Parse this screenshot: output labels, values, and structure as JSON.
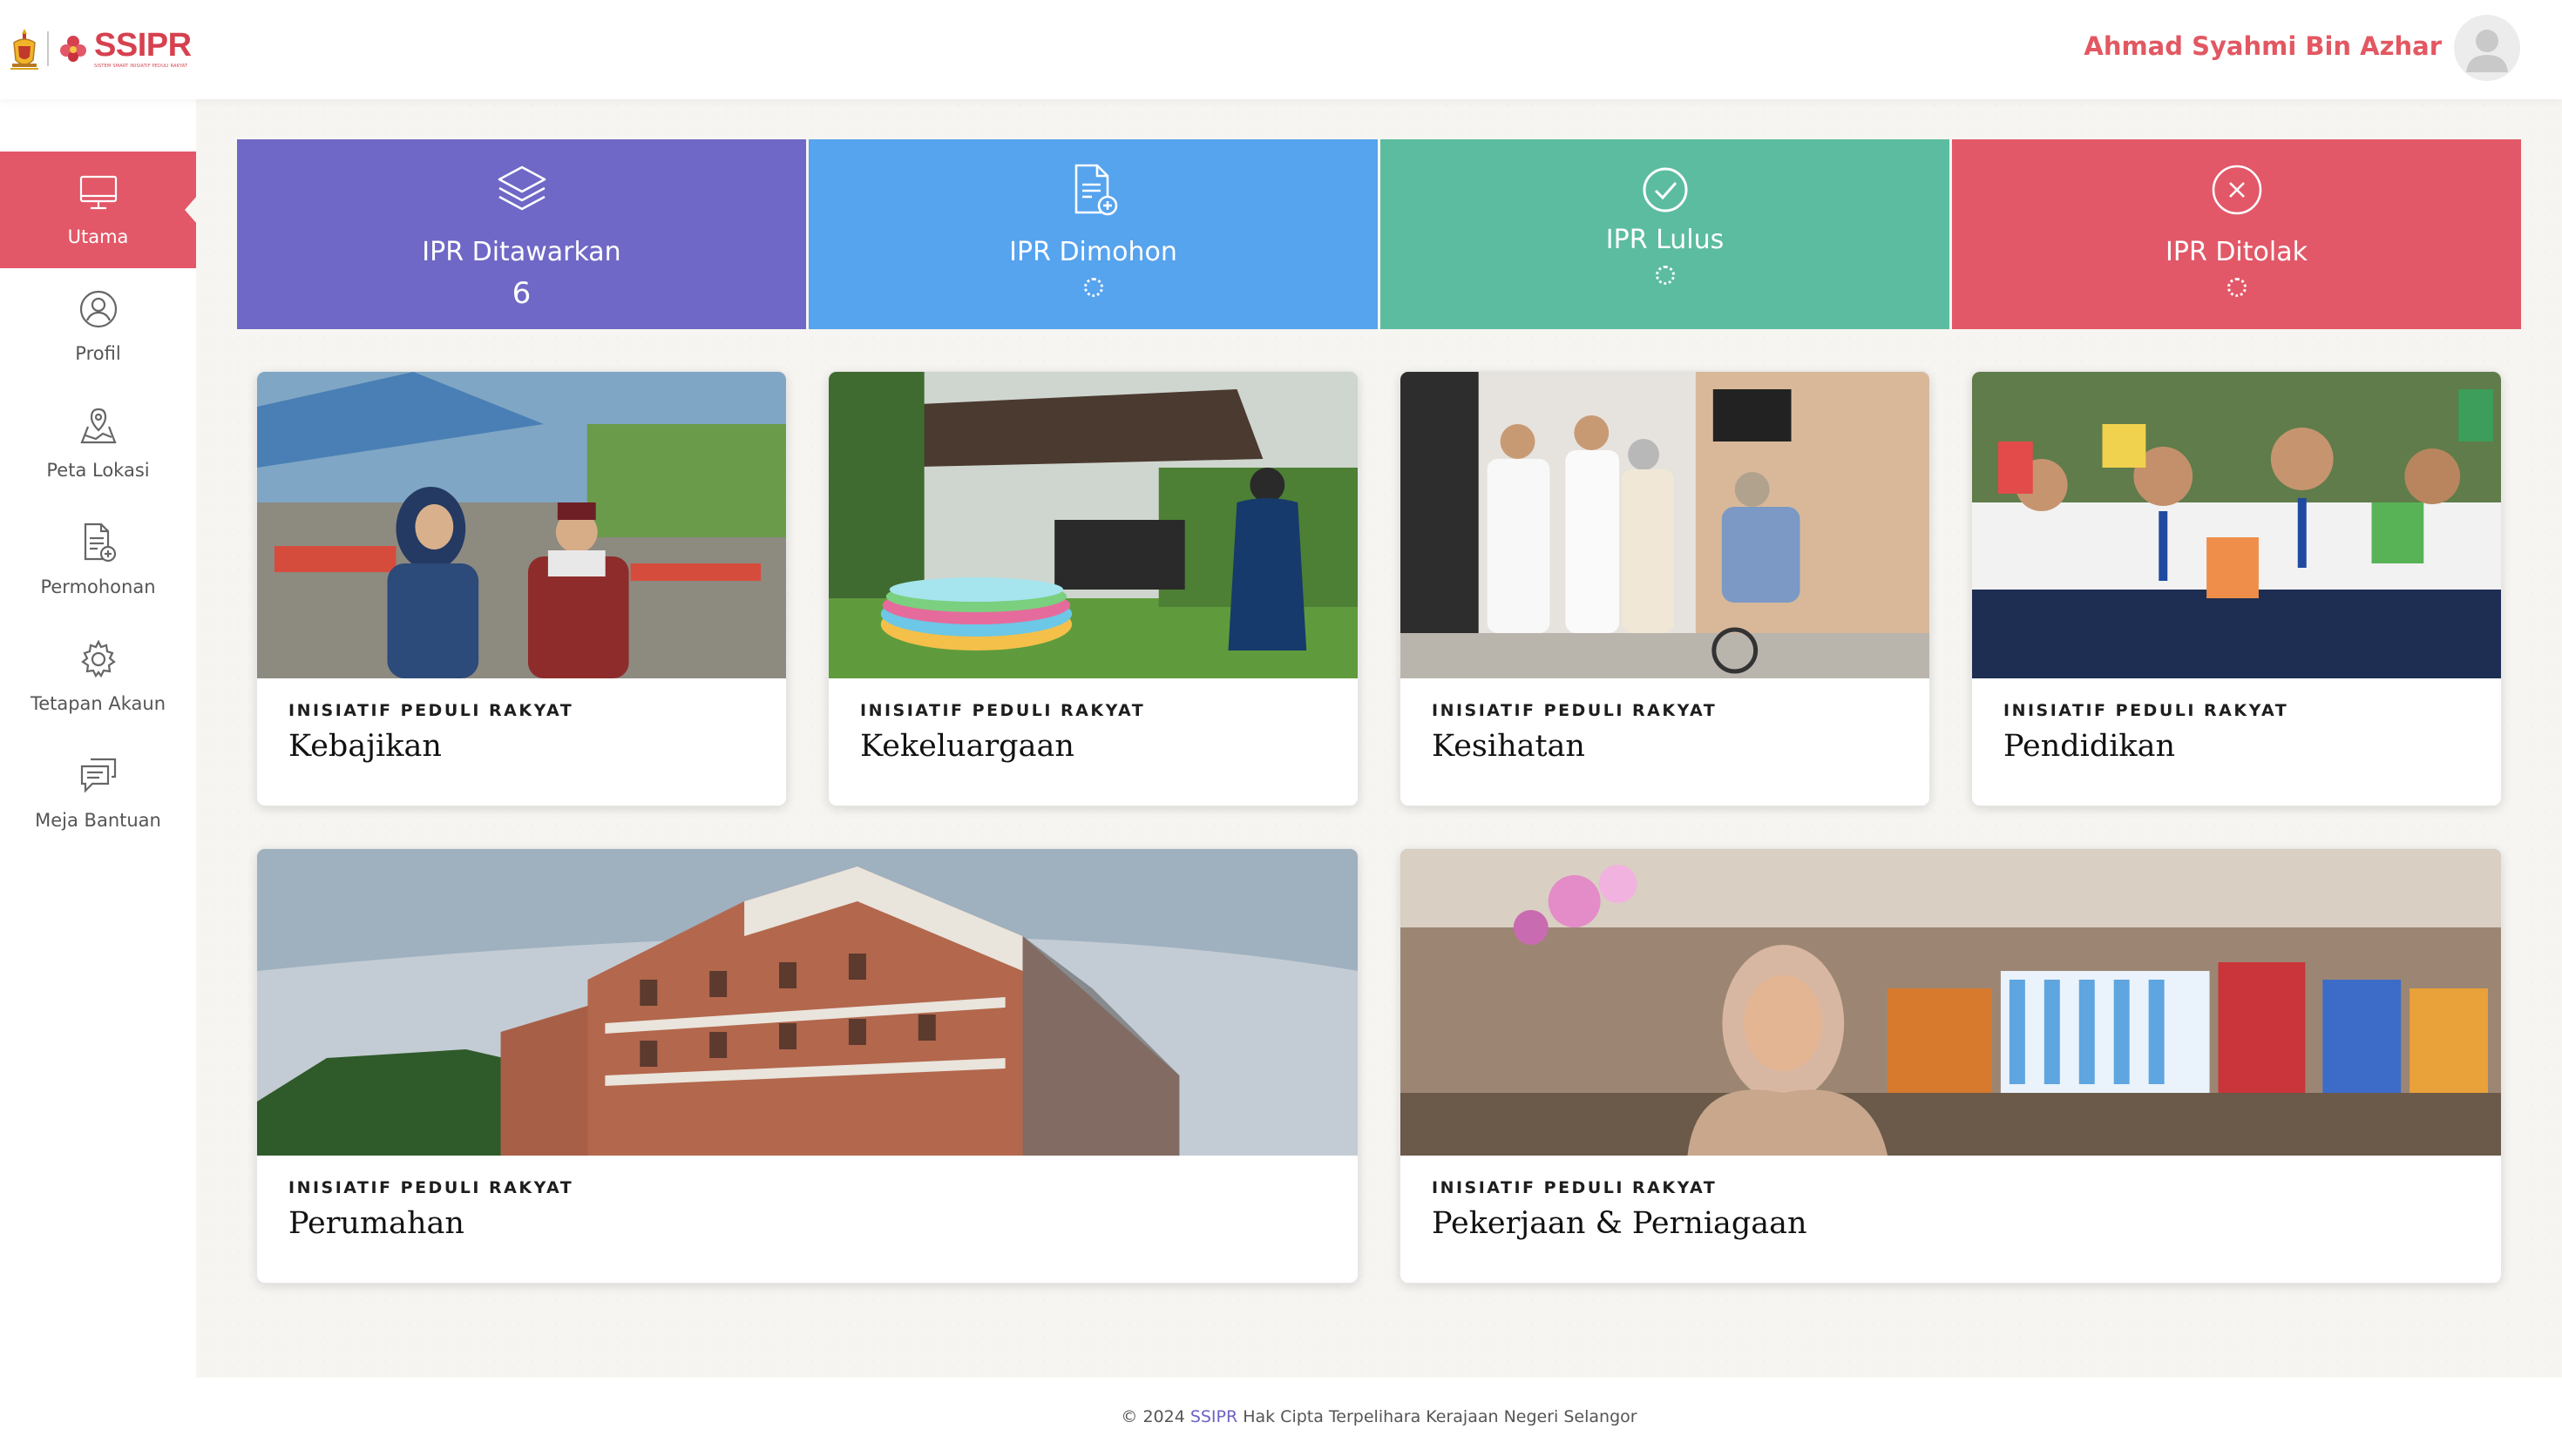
{
  "app": {
    "logo_text": "SSIPR",
    "logo_subtext": "SISTEM SMART INISIATIF PEDULI RAKYAT",
    "user_name": "Ahmad Syahmi Bin Azhar"
  },
  "sidebar": {
    "items": [
      {
        "label": "Utama",
        "icon": "monitor-icon",
        "active": true
      },
      {
        "label": "Profil",
        "icon": "user-circle-icon",
        "active": false
      },
      {
        "label": "Peta Lokasi",
        "icon": "map-pin-icon",
        "active": false
      },
      {
        "label": "Permohonan",
        "icon": "document-add-icon",
        "active": false
      },
      {
        "label": "Tetapan Akaun",
        "icon": "gear-icon",
        "active": false
      },
      {
        "label": "Meja Bantuan",
        "icon": "chat-icon",
        "active": false
      }
    ]
  },
  "stats": [
    {
      "label": "IPR Ditawarkan",
      "value": "6",
      "icon": "layers-icon",
      "color": "#6f68c6"
    },
    {
      "label": "IPR Dimohon",
      "value": "",
      "icon": "document-add-icon",
      "color": "#56a3ee"
    },
    {
      "label": "IPR Lulus",
      "value": "",
      "icon": "check-circle-icon",
      "color": "#5cbca0"
    },
    {
      "label": "IPR Ditolak",
      "value": "",
      "icon": "x-circle-icon",
      "color": "#e25868"
    }
  ],
  "cards": [
    {
      "kicker": "INISIATIF PEDULI RAKYAT",
      "title": "Kebajikan"
    },
    {
      "kicker": "INISIATIF PEDULI RAKYAT",
      "title": "Kekeluargaan"
    },
    {
      "kicker": "INISIATIF PEDULI RAKYAT",
      "title": "Kesihatan"
    },
    {
      "kicker": "INISIATIF PEDULI RAKYAT",
      "title": "Pendidikan"
    },
    {
      "kicker": "INISIATIF PEDULI RAKYAT",
      "title": "Perumahan"
    },
    {
      "kicker": "INISIATIF PEDULI RAKYAT",
      "title": "Pekerjaan & Perniagaan"
    }
  ],
  "footer": {
    "prefix": "© 2024",
    "brand": "SSIPR",
    "suffix": "Hak Cipta Terpelihara Kerajaan Negeri Selangor"
  },
  "colors": {
    "accent": "#e25868",
    "purple": "#6f68c6",
    "blue": "#56a3ee",
    "green": "#5cbca0",
    "red": "#e25868"
  }
}
